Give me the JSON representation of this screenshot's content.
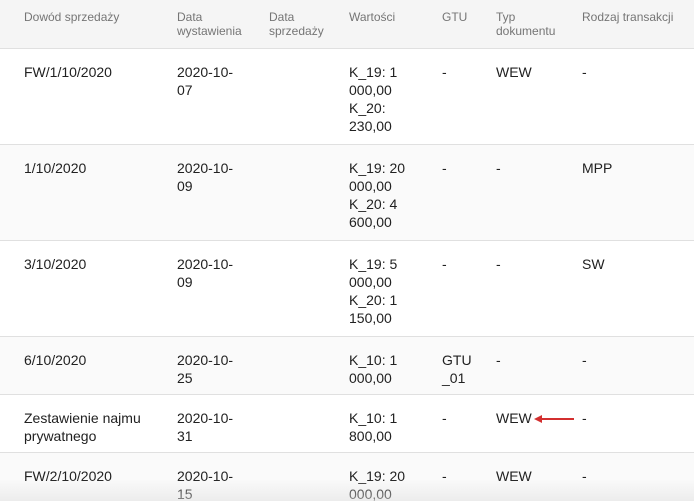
{
  "headers": {
    "dowod": "Dowód sprzedaży",
    "data_wyst": "Data wystawienia",
    "data_sprz": "Data sprzedaży",
    "wartosci": "Wartości",
    "gtu": "GTU",
    "typ": "Typ dokumentu",
    "rodzaj": "Rodzaj transakcji"
  },
  "rows": [
    {
      "dowod": "FW/1/10/2020",
      "data_wyst": "2020-10-07",
      "data_sprz": "",
      "wartosci": "K_19: 1 000,00 K_20: 230,00",
      "gtu": "-",
      "typ": "WEW",
      "rodzaj": "-"
    },
    {
      "dowod": "1/10/2020",
      "data_wyst": "2020-10-09",
      "data_sprz": "",
      "wartosci": "K_19: 20 000,00 K_20: 4 600,00",
      "gtu": "-",
      "typ": "-",
      "rodzaj": "MPP"
    },
    {
      "dowod": "3/10/2020",
      "data_wyst": "2020-10-09",
      "data_sprz": "",
      "wartosci": "K_19: 5 000,00 K_20: 1 150,00",
      "gtu": "-",
      "typ": "-",
      "rodzaj": "SW"
    },
    {
      "dowod": "6/10/2020",
      "data_wyst": "2020-10-25",
      "data_sprz": "",
      "wartosci": "K_10: 1 000,00",
      "gtu": "GTU_01",
      "typ": "-",
      "rodzaj": "-"
    },
    {
      "dowod": "Zestawienie najmu prywatnego",
      "data_wyst": "2020-10-31",
      "data_sprz": "",
      "wartosci": "K_10: 1 800,00",
      "gtu": "-",
      "typ": "WEW",
      "rodzaj": "-"
    },
    {
      "dowod": "FW/2/10/2020",
      "data_wyst": "2020-10-15",
      "data_sprz": "",
      "wartosci": "K_19: 20 000,00",
      "gtu": "-",
      "typ": "WEW",
      "rodzaj": "-"
    }
  ],
  "annotation": {
    "arrow_color": "#d32f2f",
    "arrow_icon": "arrow-left-icon"
  },
  "colors": {
    "header_bg": "#f5f5f5",
    "header_text": "#757575",
    "row_shaded_bg": "#fafafa",
    "divider": "#e0e0e0"
  }
}
